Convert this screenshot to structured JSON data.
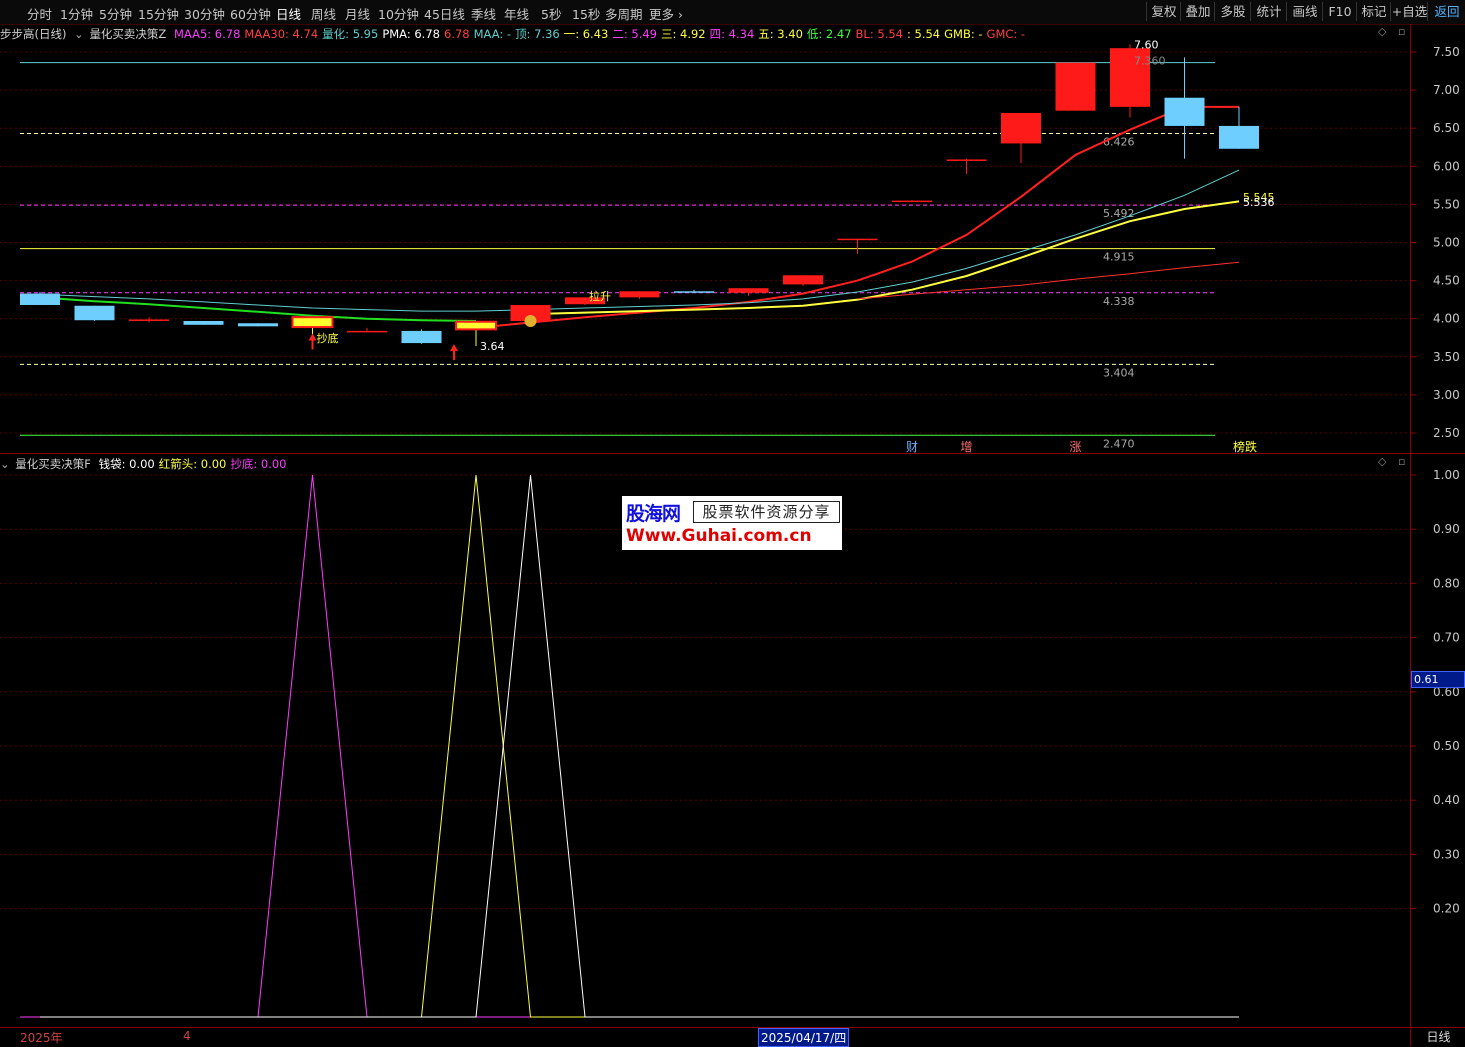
{
  "toolbar": {
    "periods": [
      "分时",
      "1分钟",
      "5分钟",
      "15分钟",
      "30分钟",
      "60分钟",
      "日线",
      "周线",
      "月线",
      "10分钟",
      "45日线",
      "季线",
      "年线",
      "5秒",
      "15秒",
      "多周期",
      "更多"
    ],
    "active": "日线",
    "right_buttons": [
      "复权",
      "叠加",
      "多股",
      "统计",
      "画线",
      "F10",
      "标记",
      "+自选",
      "返回"
    ]
  },
  "main_panel": {
    "stock_title": "步步高(日线)",
    "indicator_name": "量化买卖决策Z",
    "legend": [
      {
        "label": "MAA5: ",
        "value": "6.78",
        "color": "#ff3cff"
      },
      {
        "label": "MAA30: ",
        "value": "4.74",
        "color": "#ff4040"
      },
      {
        "label": "量化: ",
        "value": "5.95",
        "color": "#5fd0d0"
      },
      {
        "label": "PMA: ",
        "value": "6.78",
        "color": "#ffffff"
      },
      {
        "label": "",
        "value": "6.78",
        "color": "#ff4040"
      },
      {
        "label": "MAA: ",
        "value": "-",
        "color": "#5fd0d0"
      },
      {
        "label": "顶: ",
        "value": "7.36",
        "color": "#5fd0d0"
      },
      {
        "label": "一: ",
        "value": "6.43",
        "color": "#ffff40"
      },
      {
        "label": "二: ",
        "value": "5.49",
        "color": "#ff3cff"
      },
      {
        "label": "三: ",
        "value": "4.92",
        "color": "#ffff40"
      },
      {
        "label": "四: ",
        "value": "4.34",
        "color": "#ff3cff"
      },
      {
        "label": "五: ",
        "value": "3.40",
        "color": "#ffff40"
      },
      {
        "label": "低: ",
        "value": "2.47",
        "color": "#40ff40"
      },
      {
        "label": "BL: ",
        "value": "5.54",
        "color": "#ff4040"
      },
      {
        "label": ": ",
        "value": "5.54",
        "color": "#ffff40"
      },
      {
        "label": "GMB: ",
        "value": "-",
        "color": "#ffff40"
      },
      {
        "label": "GMC: ",
        "value": "-",
        "color": "#ff4040"
      }
    ]
  },
  "sub_panel": {
    "indicator_name": "量化买卖决策F",
    "legend": [
      {
        "label": "钱袋: ",
        "value": "0.00",
        "color": "#ffffff"
      },
      {
        "label": "红箭头: ",
        "value": "0.00",
        "color": "#ffff40"
      },
      {
        "label": "抄底: ",
        "value": "0.00",
        "color": "#ff3cff"
      }
    ],
    "crosshair_value": "0.61"
  },
  "watermark": {
    "brand": "股海网",
    "tagline": "股票软件资源分享",
    "url": "Www.Guhai.com.cn"
  },
  "bottom_bar": {
    "year": "2025年",
    "month": "4",
    "date": "2025/04/17/四",
    "period": "日线"
  },
  "chart_data": [
    {
      "type": "candlestick",
      "ylim": [
        2.4,
        7.6
      ],
      "yticks": [
        2.5,
        3.0,
        3.5,
        4.0,
        4.5,
        5.0,
        5.5,
        6.0,
        6.5,
        7.0,
        7.5
      ],
      "candles": [
        {
          "o": 4.33,
          "h": 4.35,
          "l": 4.18,
          "c": 4.18
        },
        {
          "o": 4.17,
          "h": 4.17,
          "l": 3.97,
          "c": 3.98
        },
        {
          "o": 3.99,
          "h": 4.02,
          "l": 3.95,
          "c": 3.99
        },
        {
          "o": 3.97,
          "h": 3.97,
          "l": 3.92,
          "c": 3.92
        },
        {
          "o": 3.94,
          "h": 3.94,
          "l": 3.9,
          "c": 3.9
        },
        {
          "o": 3.89,
          "h": 4.02,
          "l": 3.78,
          "c": 4.02
        },
        {
          "o": 3.84,
          "h": 3.88,
          "l": 3.82,
          "c": 3.84
        },
        {
          "o": 3.84,
          "h": 3.86,
          "l": 3.67,
          "c": 3.68
        },
        {
          "o": 3.86,
          "h": 3.96,
          "l": 3.64,
          "c": 3.96
        },
        {
          "o": 3.97,
          "h": 4.18,
          "l": 3.95,
          "c": 4.18
        },
        {
          "o": 4.19,
          "h": 4.28,
          "l": 4.18,
          "c": 4.28
        },
        {
          "o": 4.28,
          "h": 4.36,
          "l": 4.26,
          "c": 4.36
        },
        {
          "o": 4.36,
          "h": 4.38,
          "l": 4.34,
          "c": 4.34
        },
        {
          "o": 4.34,
          "h": 4.4,
          "l": 4.3,
          "c": 4.4
        },
        {
          "o": 4.45,
          "h": 4.57,
          "l": 4.43,
          "c": 4.57
        },
        {
          "o": 5.05,
          "h": 5.05,
          "l": 4.85,
          "c": 5.05
        },
        {
          "o": 5.55,
          "h": 5.56,
          "l": 5.55,
          "c": 5.55
        },
        {
          "o": 6.09,
          "h": 6.1,
          "l": 5.9,
          "c": 6.09
        },
        {
          "o": 6.3,
          "h": 6.7,
          "l": 6.04,
          "c": 6.7
        },
        {
          "o": 6.73,
          "h": 7.36,
          "l": 6.73,
          "c": 7.36
        },
        {
          "o": 6.78,
          "h": 7.6,
          "l": 6.64,
          "c": 7.55
        },
        {
          "o": 6.9,
          "h": 7.43,
          "l": 6.1,
          "c": 6.53
        },
        {
          "o": 6.53,
          "h": 6.78,
          "l": 6.23,
          "c": 6.23
        }
      ],
      "levels": [
        {
          "name": "顶",
          "value": 7.36,
          "color": "#5fd0d0",
          "style": "solid",
          "label": ""
        },
        {
          "name": "一",
          "value": 6.43,
          "color": "#ffffa0",
          "style": "dashed",
          "label": "6.426"
        },
        {
          "name": "二",
          "value": 5.49,
          "color": "#ff3cff",
          "style": "dashed",
          "label": "5.492"
        },
        {
          "name": "三",
          "value": 4.92,
          "color": "#ffff40",
          "style": "solid",
          "label": "4.915"
        },
        {
          "name": "四",
          "value": 4.34,
          "color": "#ff3cff",
          "style": "dashed",
          "label": "4.338"
        },
        {
          "name": "五",
          "value": 3.4,
          "color": "#ffffa0",
          "style": "dashed",
          "label": "3.404"
        },
        {
          "name": "低",
          "value": 2.47,
          "color": "#40ff40",
          "style": "solid",
          "label": "2.470"
        }
      ],
      "lines": [
        {
          "name": "MAA5",
          "color": "#ff2020",
          "width": 2,
          "values": [
            null,
            null,
            null,
            null,
            null,
            null,
            null,
            null,
            3.88,
            3.95,
            4.02,
            4.08,
            4.14,
            4.22,
            4.33,
            4.5,
            4.75,
            5.1,
            5.6,
            6.15,
            6.48,
            6.78,
            6.78
          ]
        },
        {
          "name": "量化",
          "color": "#5fd0d0",
          "width": 1,
          "values": [
            4.32,
            4.29,
            4.26,
            4.22,
            4.18,
            4.14,
            4.12,
            4.1,
            4.1,
            4.12,
            4.14,
            4.16,
            4.18,
            4.21,
            4.26,
            4.35,
            4.48,
            4.66,
            4.88,
            5.1,
            5.35,
            5.62,
            5.95
          ]
        },
        {
          "name": "PMA",
          "color": "#ffff40",
          "width": 2,
          "values": [
            null,
            null,
            null,
            null,
            null,
            null,
            null,
            null,
            null,
            4.06,
            4.08,
            4.1,
            4.12,
            4.14,
            4.17,
            4.25,
            4.38,
            4.56,
            4.8,
            5.05,
            5.28,
            5.44,
            5.54
          ]
        },
        {
          "name": "MAA30",
          "color": "#ff3030",
          "width": 1,
          "values": [
            null,
            null,
            null,
            null,
            null,
            null,
            null,
            null,
            null,
            null,
            null,
            null,
            null,
            null,
            null,
            4.26,
            4.32,
            4.38,
            4.44,
            4.52,
            4.59,
            4.67,
            4.74
          ]
        },
        {
          "name": "green",
          "color": "#20e020",
          "width": 2,
          "values": [
            4.28,
            4.23,
            4.19,
            4.14,
            4.09,
            4.04,
            4.0,
            3.98,
            3.97,
            null,
            null,
            null,
            null,
            null,
            null,
            null,
            null,
            null,
            null,
            null,
            null,
            null,
            null
          ]
        }
      ],
      "annotations": [
        {
          "text": "抄底",
          "x": 5,
          "y": 3.75,
          "color": "#ffff40"
        },
        {
          "text": "3.64",
          "x": 8,
          "y": 3.64,
          "color": "#ffffff"
        },
        {
          "text": "7.60",
          "x": 20,
          "y": 7.6,
          "color": "#ffffff"
        },
        {
          "text": "7.360",
          "x": 20,
          "y": 7.39,
          "color": "#888888"
        },
        {
          "text": "拉升",
          "x": 10,
          "y": 4.3,
          "color": "#ffff40"
        },
        {
          "text": "5.545",
          "x": 22,
          "y": 5.6,
          "color": "#ffff40"
        },
        {
          "text": "5.536",
          "x": 22,
          "y": 5.53,
          "color": "#ffffff"
        }
      ],
      "events": [
        {
          "text": "财",
          "x": 16,
          "color": "#6fb0ff"
        },
        {
          "text": "增",
          "x": 17,
          "color": "#ff7070"
        },
        {
          "text": "涨",
          "x": 19,
          "color": "#ff7070"
        },
        {
          "text": "榜跌",
          "x": 22,
          "color": "#ffff40"
        }
      ]
    },
    {
      "type": "line",
      "ylim": [
        0,
        1.0
      ],
      "yticks": [
        0.2,
        0.3,
        0.4,
        0.5,
        0.6,
        0.7,
        0.8,
        0.9,
        1.0
      ],
      "series": [
        {
          "name": "抄底",
          "color": "#ff3cff",
          "values": [
            0,
            0,
            0,
            0,
            0,
            1,
            0,
            0,
            0,
            0,
            0,
            0,
            0,
            0,
            0,
            0,
            0,
            0,
            0,
            0,
            0,
            0,
            0
          ]
        },
        {
          "name": "红箭头",
          "color": "#ffff40",
          "values": [
            0,
            0,
            0,
            0,
            0,
            0,
            0,
            0,
            1,
            0,
            0,
            0,
            0,
            0,
            0,
            0,
            0,
            0,
            0,
            0,
            0,
            0,
            0
          ]
        },
        {
          "name": "钱袋",
          "color": "#ffffff",
          "values": [
            0,
            0,
            0,
            0,
            0,
            0,
            0,
            0,
            0,
            1,
            0,
            0,
            0,
            0,
            0,
            0,
            0,
            0,
            0,
            0,
            0,
            0,
            0
          ]
        }
      ]
    }
  ]
}
